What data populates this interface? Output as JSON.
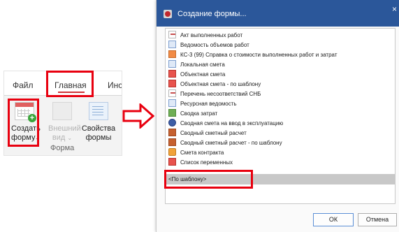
{
  "ribbon": {
    "tabs": [
      "Файл",
      "Главная",
      "Инстр"
    ],
    "buttons": {
      "create": {
        "line1": "Создать",
        "line2": "форму",
        "chevron": "⌄",
        "icon": "create-form-icon"
      },
      "view": {
        "line1": "Внешний",
        "line2": "вид",
        "chevron": "⌄",
        "icon": "external-view-icon"
      },
      "props": {
        "line1": "Свойства",
        "line2": "формы",
        "icon": "form-properties-icon"
      }
    },
    "group_label": "Форма"
  },
  "dialog": {
    "title": "Создание формы...",
    "close": "×",
    "items": [
      {
        "label": "Акт выполненных работ",
        "icon": "doc"
      },
      {
        "label": "Ведомость объемов работ",
        "icon": "blue"
      },
      {
        "label": "КС-3 (99) Справка о стоимости выполненных работ и затрат",
        "icon": "orange"
      },
      {
        "label": "Локальная смета",
        "icon": "blue"
      },
      {
        "label": "Объектная смета",
        "icon": "red"
      },
      {
        "label": "Объектная смета - по шаблону",
        "icon": "red"
      },
      {
        "label": "Перечень несоответствий СНБ",
        "icon": "doc"
      },
      {
        "label": "Ресурсная ведомость",
        "icon": "blue"
      },
      {
        "label": "Сводка затрат",
        "icon": "green"
      },
      {
        "label": "Сводная смета на ввод в эксплуатацию",
        "icon": "navy"
      },
      {
        "label": "Сводный сметный расчет",
        "icon": "brown"
      },
      {
        "label": "Сводный сметный расчет - по шаблону",
        "icon": "brown"
      },
      {
        "label": "Смета контракта",
        "icon": "gold"
      },
      {
        "label": "Список переменных",
        "icon": "red"
      }
    ],
    "selected_item": "<По шаблону>",
    "ok_label": "ОК",
    "cancel_label": "Отмена"
  },
  "colors": {
    "highlight": "#e8000f",
    "titlebar": "#2b579a",
    "tab_underline": "#d13438",
    "selection": "#c8c8c8"
  }
}
